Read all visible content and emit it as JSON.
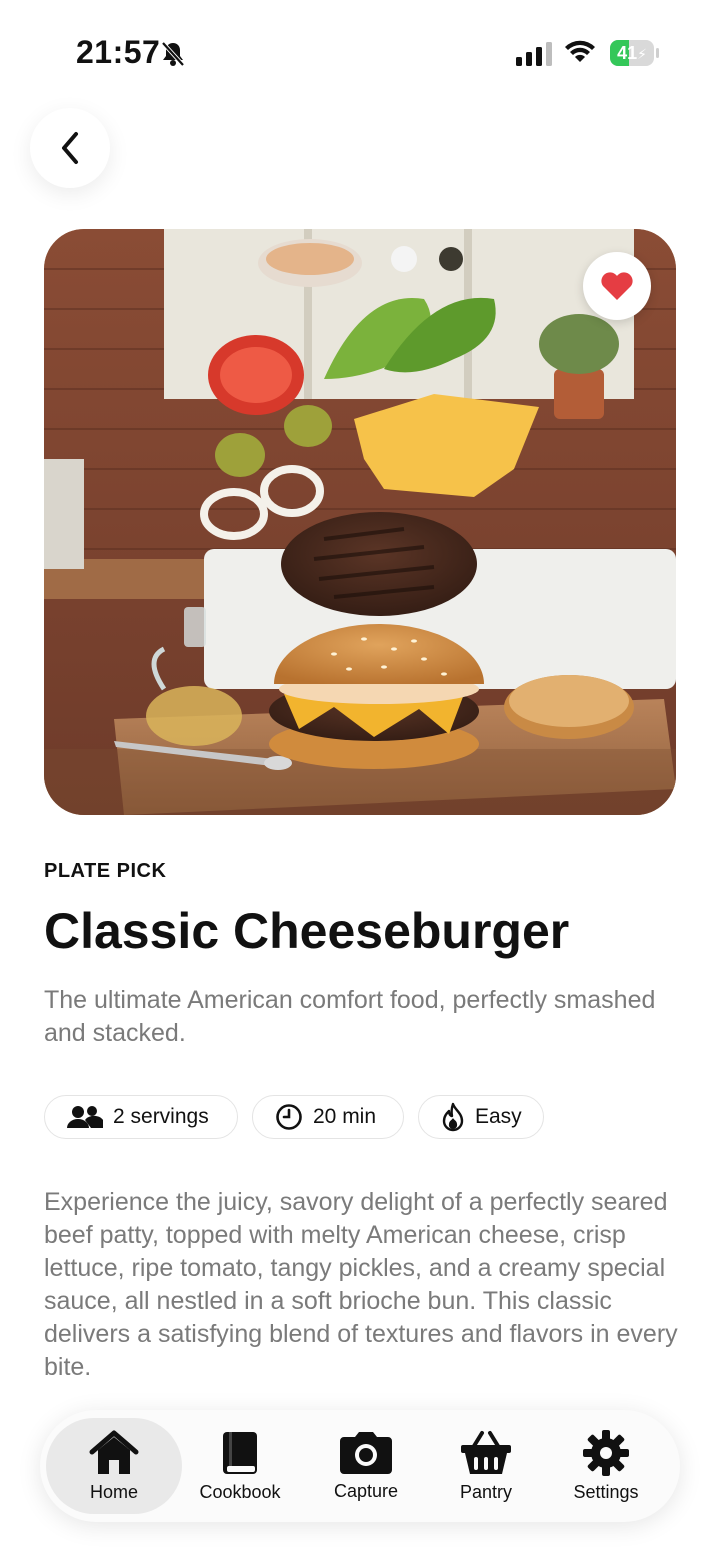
{
  "status": {
    "time": "21:57",
    "battery": "41"
  },
  "card": {
    "eyebrow": "PLATE PICK",
    "title": "Classic Cheeseburger",
    "subtitle": "The ultimate American comfort food, perfectly smashed and stacked.",
    "chips": [
      {
        "icon": "people-icon",
        "label": "2 servings"
      },
      {
        "icon": "clock-icon",
        "label": "20 min"
      },
      {
        "icon": "flame-icon",
        "label": "Easy"
      }
    ],
    "description": "Experience the juicy, savory delight of a perfectly seared beef patty, topped with melty American cheese, crisp lettuce, ripe tomato, tangy pickles, and a creamy special sauce, all nestled in a soft brioche bun. This classic delivers a satisfying blend of textures and flavors in every bite."
  },
  "tabs": [
    {
      "label": "Home",
      "icon": "home-icon",
      "active": true
    },
    {
      "label": "Cookbook",
      "icon": "book-icon",
      "active": false
    },
    {
      "label": "Capture",
      "icon": "camera-icon",
      "active": false
    },
    {
      "label": "Pantry",
      "icon": "basket-icon",
      "active": false
    },
    {
      "label": "Settings",
      "icon": "gear-icon",
      "active": false
    }
  ],
  "colors": {
    "favorite": "#e53d43",
    "muted_text": "#7a7a7a",
    "battery": "#34c759"
  }
}
